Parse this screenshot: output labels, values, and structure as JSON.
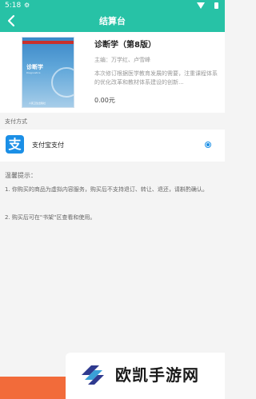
{
  "status_bar": {
    "time": "5:18",
    "gear_icon": "gear-icon",
    "wifi_icon": "wifi-icon",
    "battery_icon": "battery-icon"
  },
  "app_bar": {
    "title": "结算台",
    "back_icon": "back-arrow-icon",
    "color": "#27c2a6"
  },
  "book": {
    "title": "诊断学（第8版）",
    "author": "主编：万学红、卢雪峰",
    "description": "本次修订根据医学教育发展的需要，注重课程体系的优化改革和教材体系建设的创新...",
    "price": "0.00元",
    "cover": {
      "title": "诊断学",
      "subtitle": "Diagnostics",
      "footer": "人民卫生出版社"
    }
  },
  "payment": {
    "section_label": "支付方式",
    "method": "支付宝支付",
    "method_icon": "alipay-icon",
    "selected": true,
    "icon_color": "#1b8fe6"
  },
  "notice": {
    "title": "温馨提示：",
    "items": [
      "1. 你购买的商品为虚拟内容服务，购买后不支持退订、转让、退还，请斟酌确认。",
      "2. 购买后可在\"书架\"区查看和使用。"
    ]
  },
  "bottom_bar": {
    "color": "#f26b3a"
  },
  "watermark": {
    "text": "欧凯手游网"
  }
}
